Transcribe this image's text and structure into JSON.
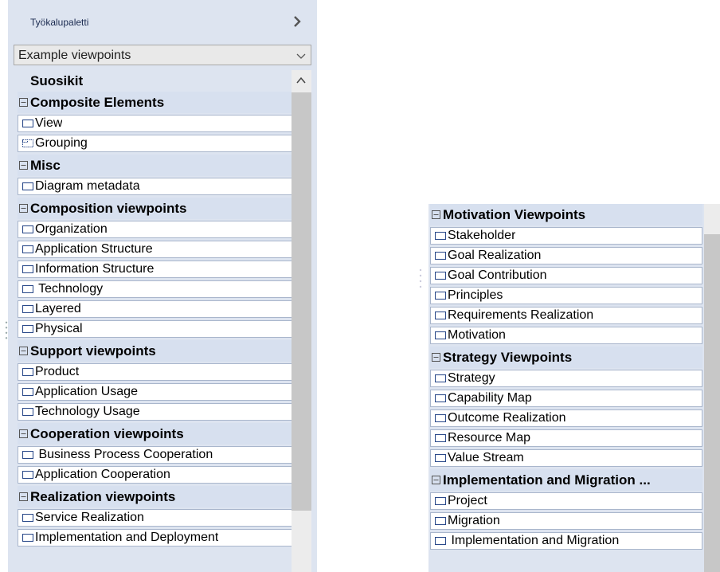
{
  "palette": {
    "title": "Työkalupaletti",
    "dropdown_value": "Example viewpoints",
    "favorites_label": "Suosikit"
  },
  "left_groups": [
    {
      "label": "Composite Elements",
      "items": [
        "View",
        "Grouping"
      ]
    },
    {
      "label": "Misc",
      "items": [
        "Diagram metadata"
      ]
    },
    {
      "label": "Composition viewpoints",
      "items": [
        "Organization",
        "Application Structure",
        "Information Structure",
        " Technology",
        "Layered",
        "Physical"
      ]
    },
    {
      "label": "Support viewpoints",
      "items": [
        "Product",
        "Application Usage",
        "Technology Usage"
      ]
    },
    {
      "label": "Cooperation viewpoints",
      "items": [
        " Business Process Cooperation",
        "Application Cooperation"
      ]
    },
    {
      "label": "Realization viewpoints",
      "items": [
        "Service Realization",
        "Implementation and Deployment"
      ]
    }
  ],
  "right_groups": [
    {
      "label": "Motivation Viewpoints",
      "items": [
        "Stakeholder",
        "Goal Realization",
        "Goal Contribution",
        "Principles",
        "Requirements Realization",
        "Motivation"
      ]
    },
    {
      "label": "Strategy Viewpoints",
      "items": [
        "Strategy",
        "Capability Map",
        "Outcome Realization",
        "Resource Map",
        "Value Stream"
      ]
    },
    {
      "label": "Implementation and Migration ...",
      "items": [
        "Project",
        "Migration",
        " Implementation and Migration"
      ]
    }
  ],
  "icons": {
    "item": "view-rect-icon",
    "grouping": "grouping-dashed-icon",
    "collapse": "collapse-minus-icon"
  },
  "colors": {
    "panel_bg": "#dde4f0",
    "header_bg": "#d7e0ef",
    "item_border": "#a9b6cc",
    "icon_blue": "#2b4a8a"
  }
}
